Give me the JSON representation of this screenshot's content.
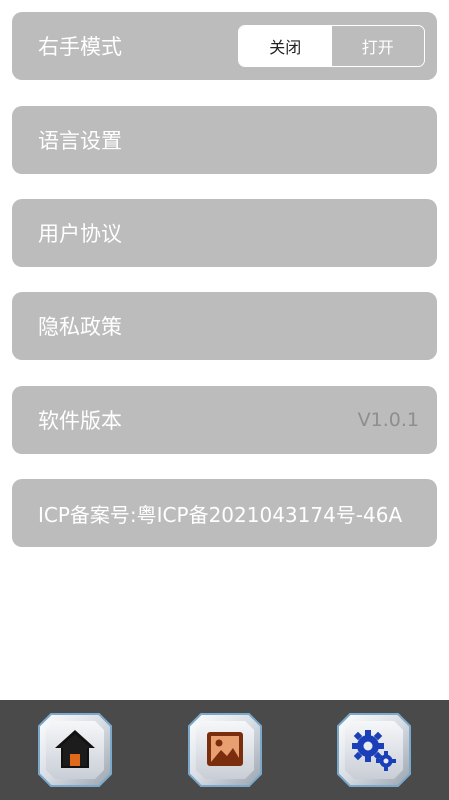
{
  "settings": {
    "right_hand_mode": {
      "label": "右手模式",
      "toggle_off": "关闭",
      "toggle_on": "打开",
      "selected": "关闭"
    },
    "language": {
      "label": "语言设置"
    },
    "user_agreement": {
      "label": "用户协议"
    },
    "privacy_policy": {
      "label": "隐私政策"
    },
    "software_version": {
      "label": "软件版本",
      "value": "V1.0.1"
    },
    "icp": {
      "label": "ICP备案号:粤ICP备2021043174号-46A"
    }
  },
  "bottom_nav": {
    "items": [
      {
        "icon": "home-icon"
      },
      {
        "icon": "picture-icon"
      },
      {
        "icon": "gear-icon"
      }
    ]
  },
  "colors": {
    "row_bg": "#bcbcbc",
    "bottom_bar": "#4a4a4a",
    "home_accent": "#e06a1a",
    "gear_accent": "#1a3fb8"
  }
}
